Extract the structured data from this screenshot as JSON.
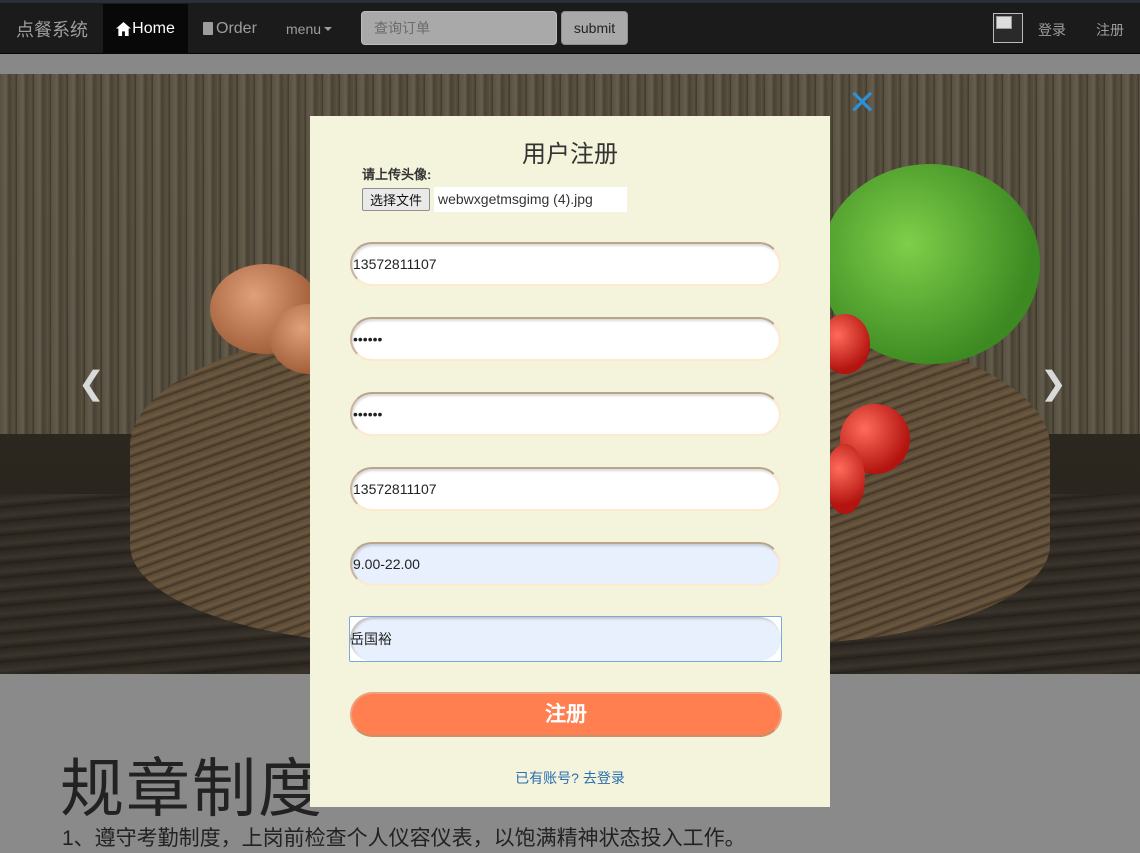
{
  "navbar": {
    "brand": "点餐系统",
    "home_label": "Home",
    "order_label": "Order",
    "menu_label": "menu",
    "search_placeholder": "查询订单",
    "submit_label": "submit",
    "login_label": "登录",
    "register_label": "注册"
  },
  "carousel": {
    "prev_glyph": "❮",
    "next_glyph": "❯"
  },
  "content": {
    "rules_title": "规章制度",
    "rules_line_1": "1、遵守考勤制度，上岗前检查个人仪容仪表，以饱满精神状态投入工作。"
  },
  "modal": {
    "close_glyph": "✕",
    "title": "用户注册",
    "upload_label": "请上传头像:",
    "file_button_label": "选择文件",
    "file_name": "webwxgetmsgimg (4).jpg",
    "fields": {
      "phone": "13572811107",
      "password": "••••••",
      "confirm_password": "••••••",
      "phone_2": "13572811107",
      "hours": "9.00-22.00",
      "name": "岳国裕"
    },
    "submit_label": "注册",
    "login_link": "已有账号? 去登录"
  },
  "colors": {
    "navbar_bg": "#1b1b1b",
    "modal_bg": "#f4f4dc",
    "register_button": "#ff7f50",
    "close_icon": "#2f8fd0",
    "link": "#2a6fb0"
  }
}
